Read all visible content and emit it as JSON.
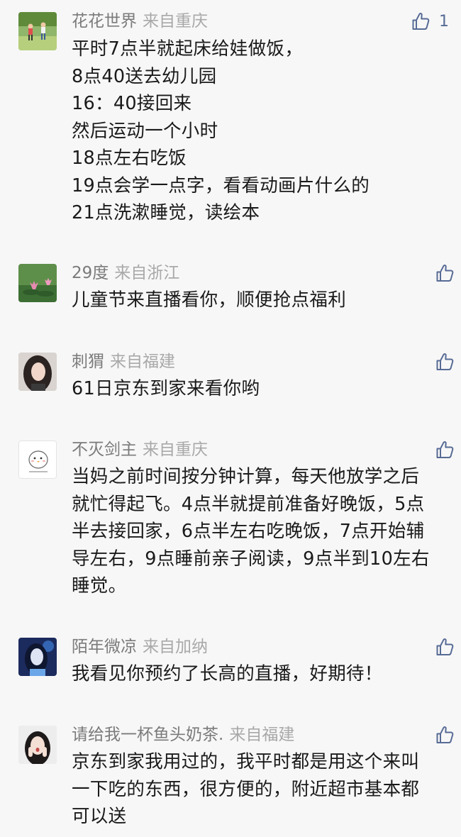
{
  "comments": [
    {
      "nickname": "花花世界",
      "location": "来自重庆",
      "likes": "1",
      "avatar_icon": "kids-running-photo",
      "text": "平时7点半就起床给娃做饭，\n8点40送去幼儿园\n16：40接回来\n然后运动一个小时\n18点左右吃饭\n19点会学一点字，看看动画片什么的\n21点洗漱睡觉，读绘本"
    },
    {
      "nickname": "29度",
      "location": "来自浙江",
      "likes": "",
      "avatar_icon": "lotus-photo",
      "text": "儿童节来直播看你，顺便抢点福利"
    },
    {
      "nickname": "刺猬",
      "location": "来自福建",
      "likes": "",
      "avatar_icon": "girl-portrait-photo",
      "text": "61日京东到家来看你哟"
    },
    {
      "nickname": "不灭剑主",
      "location": "来自重庆",
      "likes": "",
      "avatar_icon": "cartoon-chick-drawing",
      "text": "当妈之前时间按分钟计算，每天他放学之后就忙得起飞。4点半就提前准备好晚饭，5点半去接回家，6点半左右吃晚饭，7点开始辅导左右，9点睡前亲子阅读，9点半到10左右睡觉。"
    },
    {
      "nickname": "陌年微凉",
      "location": "来自加纳",
      "likes": "",
      "avatar_icon": "blue-portrait-photo",
      "text": "我看见你预约了长高的直播，好期待！"
    },
    {
      "nickname": "请给我一杯鱼头奶茶.",
      "location": "来自福建",
      "likes": "",
      "avatar_icon": "girl-covering-face-photo",
      "text": "京东到家我用过的，我平时都是用这个来叫一下吃的东西，很方便的，附近超市基本都可以送"
    }
  ],
  "colors": {
    "background": "#f7f7f7",
    "nickname": "#7b7b7b",
    "location": "#a9a9a9",
    "body_text": "#1a1a1a",
    "like_icon": "#576b95"
  }
}
